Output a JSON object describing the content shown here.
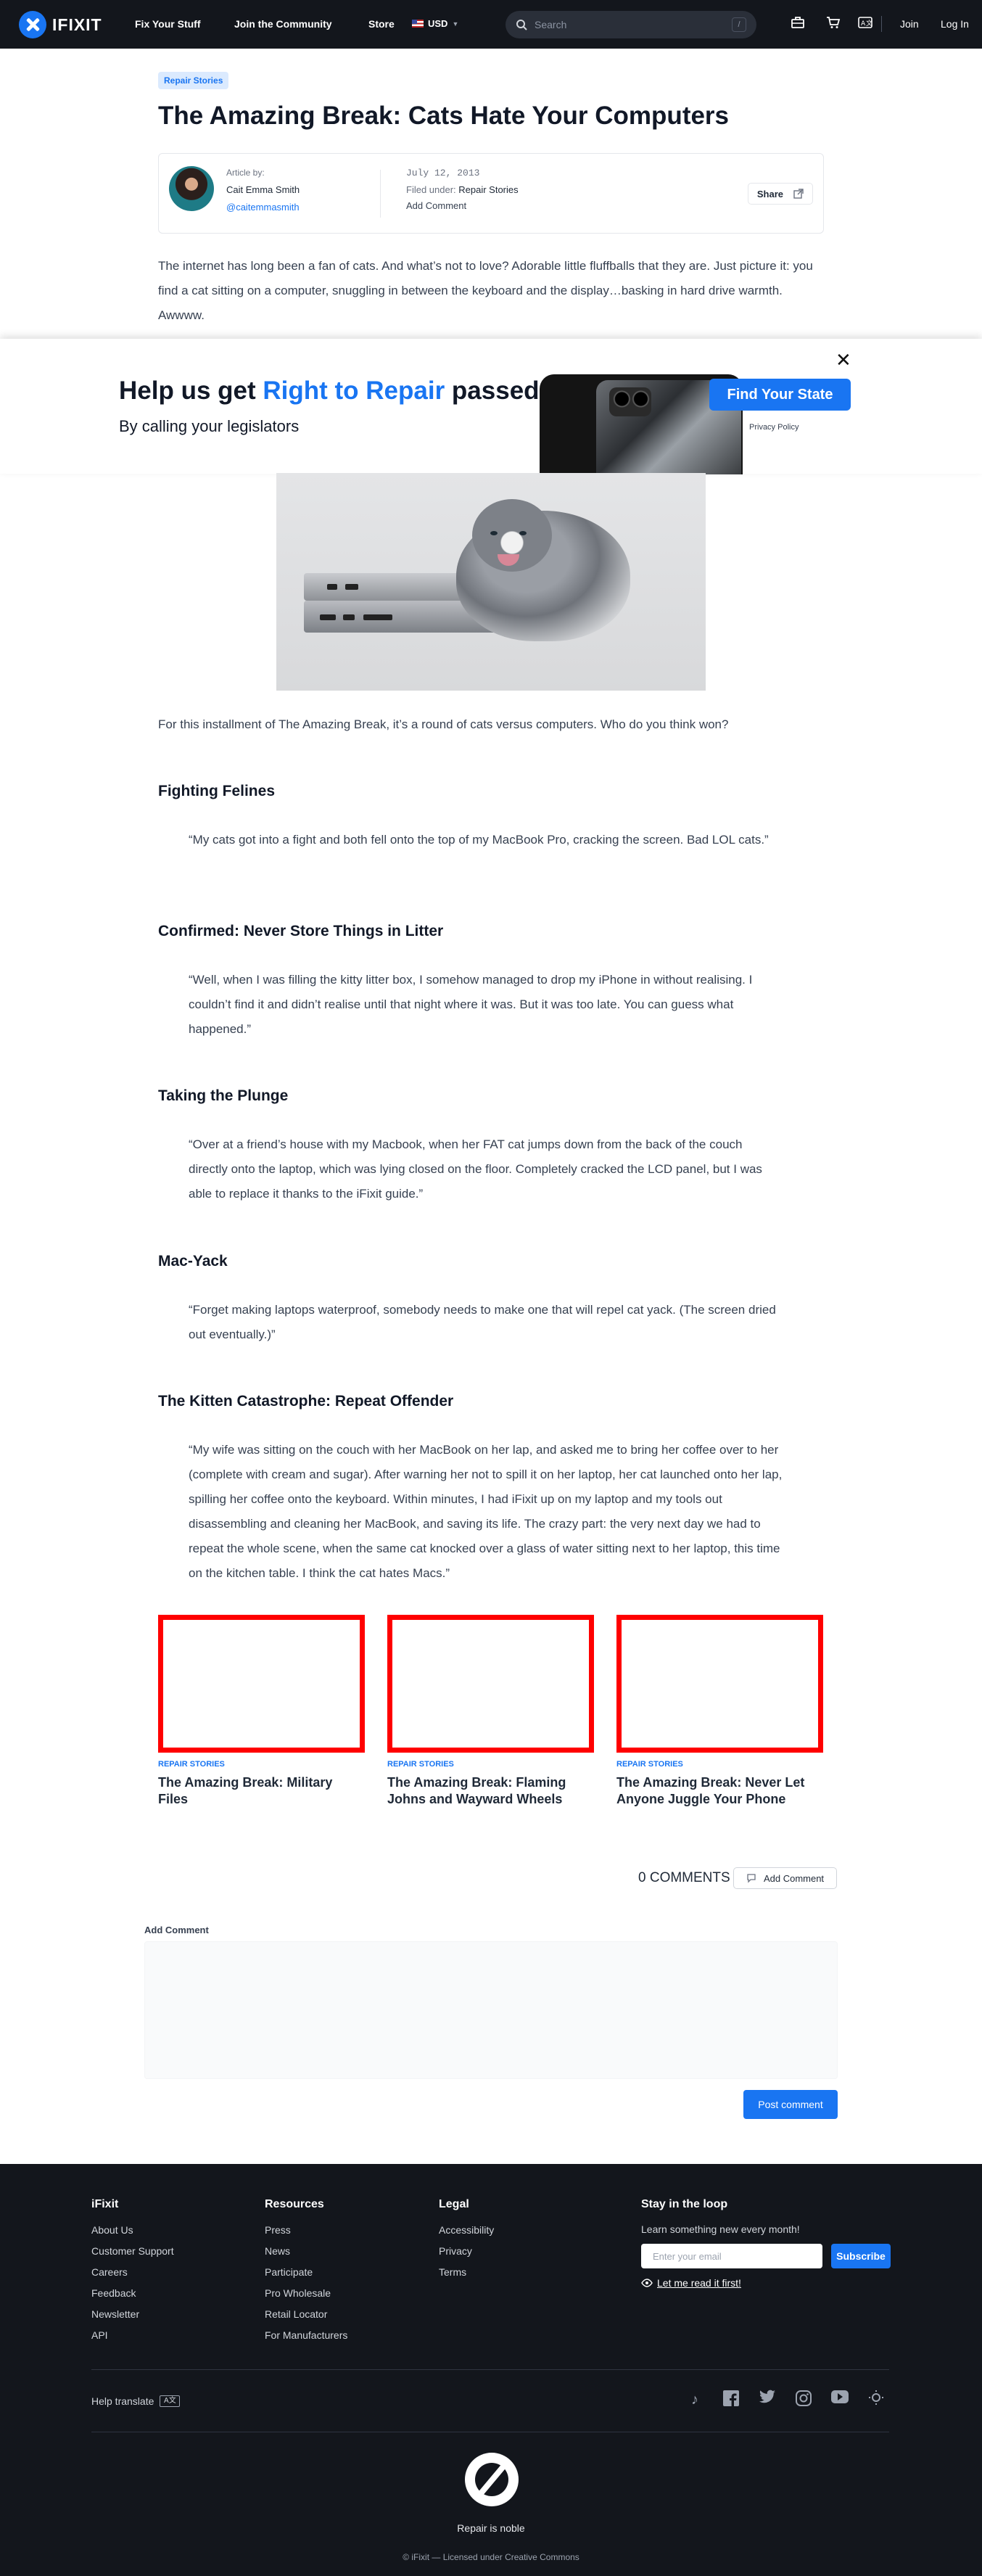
{
  "nav": {
    "logo_text": "IFIXIT",
    "links": [
      "Fix Your Stuff",
      "Join the Community",
      "Store"
    ],
    "currency": "USD",
    "search_placeholder": "Search",
    "search_shortcut": "/",
    "join": "Join",
    "login": "Log In"
  },
  "article": {
    "tag": "Repair Stories",
    "title": "The Amazing Break: Cats Hate Your Computers",
    "byline": {
      "label": "Article by:",
      "author": "Cait Emma Smith",
      "handle": "@caitemmasmith",
      "date": "July 12, 2013",
      "filed_label": "Filed under: ",
      "filed_value": "Repair Stories",
      "add_comment": "Add Comment",
      "share": "Share"
    },
    "intro": "The internet has long been a fan of cats. And what’s not to love? Adorable little fluffballs that they are. Just picture it: you find a cat sitting on a computer, snuggling in between the keyboard and the display…basking in hard drive warmth. Awwww.",
    "lead": "For this installment of The Amazing Break, it’s a round of cats versus computers. Who do you think won?",
    "sections": [
      {
        "heading": "Fighting Felines",
        "quote": "“My cats got into a fight and both fell onto the top of my MacBook Pro, cracking the screen. Bad LOL cats.”"
      },
      {
        "heading": "Confirmed: Never Store Things in Litter",
        "quote": "“Well, when I was filling the kitty litter box, I somehow managed to drop my iPhone in without realising. I couldn’t find it and didn’t realise until that night where it was. But it was too late. You can guess what happened.”"
      },
      {
        "heading": "Taking the Plunge",
        "quote": "“Over at a friend’s house with my Macbook, when her FAT cat jumps down from the back of the couch directly onto the laptop, which was lying closed on the floor. Completely cracked the LCD panel, but I was able to replace it thanks to the iFixit guide.”"
      },
      {
        "heading": "Mac-Yack",
        "quote": "“Forget making laptops waterproof, somebody needs to make one that will repel cat yack. (The screen dried out eventually.)”"
      },
      {
        "heading": "The Kitten Catastrophe: Repeat Offender",
        "quote": "“My wife was sitting on the couch with her MacBook on her lap, and asked me to bring her coffee over to her (complete with cream and sugar). After warning her not to spill it on her laptop, her cat launched onto her lap, spilling her coffee onto the keyboard. Within minutes, I had iFixit up on my laptop and my tools out disassembling and cleaning her MacBook, and saving its life. The crazy part: the very next day we had to repeat the whole scene, when the same cat knocked over a glass of water sitting next to her laptop, this time on the kitchen table. I think the cat hates Macs.”"
      }
    ]
  },
  "banner": {
    "title_pre": "Help us get ",
    "title_hl": "Right to Repair",
    "title_post": " passed",
    "subtitle": "By calling your legislators",
    "cta": "Find Your State",
    "privacy": "Privacy Policy",
    "close": "✕"
  },
  "related": [
    {
      "tag": "REPAIR STORIES",
      "title": "The Amazing Break: Military Files"
    },
    {
      "tag": "REPAIR STORIES",
      "title": "The Amazing Break: Flaming Johns and Wayward Wheels"
    },
    {
      "tag": "REPAIR STORIES",
      "title": "The Amazing Break: Never Let Anyone Juggle Your Phone"
    }
  ],
  "comments": {
    "count": "0 COMMENTS",
    "add_button": "Add Comment",
    "form_label": "Add Comment",
    "post": "Post comment"
  },
  "footer": {
    "columns": [
      {
        "title": "iFixit",
        "items": [
          "About Us",
          "Customer Support",
          "Careers",
          "Feedback",
          "Newsletter",
          "API"
        ]
      },
      {
        "title": "Resources",
        "items": [
          "Press",
          "News",
          "Participate",
          "Pro Wholesale",
          "Retail Locator",
          "For Manufacturers"
        ]
      },
      {
        "title": "Legal",
        "items": [
          "Accessibility",
          "Privacy",
          "Terms"
        ]
      }
    ],
    "stay": {
      "title": "Stay in the loop",
      "subtitle": "Learn something new every month!",
      "email_placeholder": "Enter your email",
      "subscribe": "Subscribe",
      "read_first": "Let me read it first!"
    },
    "help_translate": "Help translate",
    "tagline": "Repair is noble",
    "copyright": "© iFixit — Licensed under Creative Commons",
    "social_icons": [
      "tiktok-icon",
      "facebook-icon",
      "twitter-icon",
      "instagram-icon",
      "youtube-icon",
      "sun-icon"
    ]
  },
  "colors": {
    "accent": "#1975f2",
    "nav_bg": "#13161c",
    "card_border": "#ff0000"
  }
}
